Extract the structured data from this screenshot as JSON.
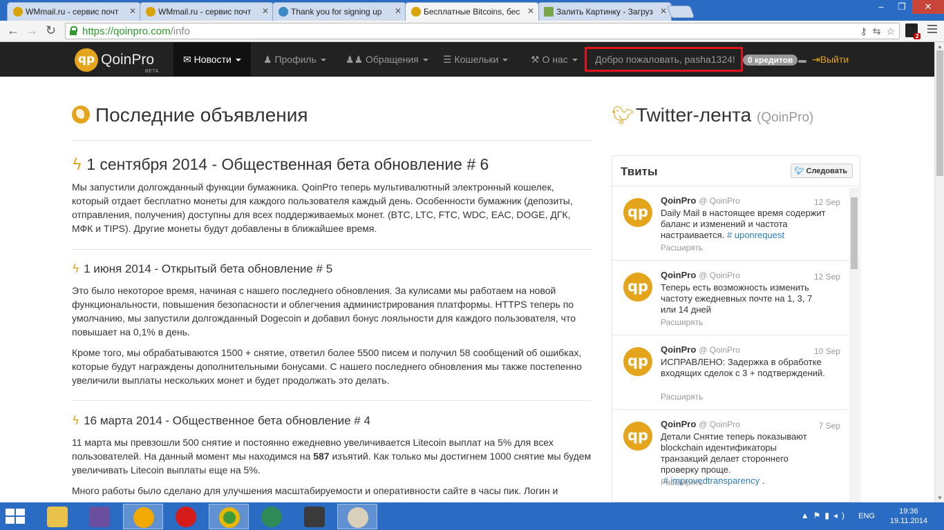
{
  "browser": {
    "tabs": [
      {
        "title": "WMmail.ru - сервис почт",
        "icon": "wmmail-favicon"
      },
      {
        "title": "WMmail.ru - сервис почт",
        "icon": "wmmail-favicon"
      },
      {
        "title": "Thank you for signing up",
        "icon": "globe-favicon"
      },
      {
        "title": "Бесплатные Bitcoins, бес",
        "icon": "qoinpro-favicon",
        "active": true
      },
      {
        "title": "Залить Картинку - Загруз",
        "icon": "image-favicon"
      }
    ],
    "url_host": "https://qoinpro.com",
    "url_path": "/info",
    "badge": "2"
  },
  "site": {
    "logo_text": "QoinPro",
    "logo_mark": "qp",
    "logo_beta": "BETA",
    "nav": [
      {
        "label": "Новости",
        "icon": "envelope-icon"
      },
      {
        "label": "Профиль",
        "icon": "user-icon"
      },
      {
        "label": "Обращения",
        "icon": "users-icon"
      },
      {
        "label": "Кошельки",
        "icon": "list-icon"
      },
      {
        "label": "О нас",
        "icon": "gavel-icon"
      }
    ],
    "welcome": "Добро пожаловать, pasha1324!",
    "credits": "0 кредитов",
    "logout": "Выйти",
    "accent_color": "#e4a51c",
    "highlight_color": "#e0141e"
  },
  "main": {
    "heading": "Последние объявления",
    "posts": [
      {
        "title": "1 сентября 2014 - Общественная бета обновление # 6",
        "paragraphs": [
          "Мы запустили долгожданный функции бумажника. QoinPro теперь мультивалютный электронный кошелек, который отдает бесплатно монеты для каждого пользователя каждый день. Особенности бумажник (депозиты, отправления, получения) доступны для всех поддерживаемых монет. (BTC, LTC, FTC, WDC, EAC, DOGE, ДГК, МФК и TIPS). Другие монеты будут добавлены в ближайшее время."
        ]
      },
      {
        "title": "1 июня 2014 - Открытый бета обновление # 5",
        "paragraphs": [
          "Это было некоторое время, начиная с нашего последнего обновления. За кулисами мы работаем на новой функциональности, повышения безопасности и облегчения администрирования платформы. HTTPS теперь по умолчанию, мы запустили долгожданный Dogecoin и добавил бонус лояльности для каждого пользователя, что повышает на 0,1% в день.",
          "Кроме того, мы обрабатываются 1500 + снятие, ответил более 5500 писем и получил 58 сообщений об ошибках, которые будут награждены дополнительными бонусами. С нашего последнего обновления мы также постепенно увеличили выплаты нескольких монет и будет продолжать это делать."
        ]
      },
      {
        "title": "16 марта 2014 - Общественное бета обновление # 4",
        "p1_before": "11 марта мы превзошли 500 снятие и постоянно ежедневно увеличивается Litecoin выплат на 5% для всех пользователей. На данный момент мы находимся на ",
        "p1_bold": "587",
        "p1_after": " изъятий. Как только мы достигнем 1000 снятие мы будем увеличивать Litecoin выплаты еще на 5%.",
        "p2": "Много работы было сделано для улучшения масштабируемости и оперативности сайте в часы пик. Логин и"
      }
    ]
  },
  "sidebar": {
    "heading": "Twitter-лента",
    "heading_sub": "(QoinPro)",
    "box_title": "Твиты",
    "follow_label": "Следовать",
    "tweets": [
      {
        "name": "QoinPro",
        "handle": "@ QoinPro",
        "date": "12 Sep",
        "text": "Daily Mail в настоящее время содержит баланс и изменений и частота настраивается.",
        "tag": "# uponrequest",
        "expand": "Расширять"
      },
      {
        "name": "QoinPro",
        "handle": "@ QoinPro",
        "date": "12 Sep",
        "text": "Теперь есть возможность изменить частоту ежедневных почте на 1, 3, 7 или 14 дней",
        "tag": "",
        "expand": "Расширять"
      },
      {
        "name": "QoinPro",
        "handle": "@ QoinPro",
        "date": "10 Sep",
        "text": "ИСПРАВЛЕНО: Задержка в обработке входящих сделок с 3 + подтверждений.",
        "tag": "",
        "expand": "Расширять"
      },
      {
        "name": "QoinPro",
        "handle": "@ QoinPro",
        "date": "7 Sep",
        "text": "Детали Снятие теперь показывают blockchain идентификаторы транзакций делает стороннего проверку проще.",
        "tag": "# improvedtransparency",
        "tag_suffix": " .",
        "expand": "Расширять"
      }
    ]
  },
  "taskbar": {
    "lang": "ENG",
    "time": "19:36",
    "date": "19.11.2014",
    "apps": [
      "file-explorer-icon",
      "visual-studio-icon",
      "aimp-icon",
      "opera-icon",
      "chrome-icon",
      "download-manager-icon",
      "world-of-tanks-icon",
      "paint-icon"
    ]
  }
}
